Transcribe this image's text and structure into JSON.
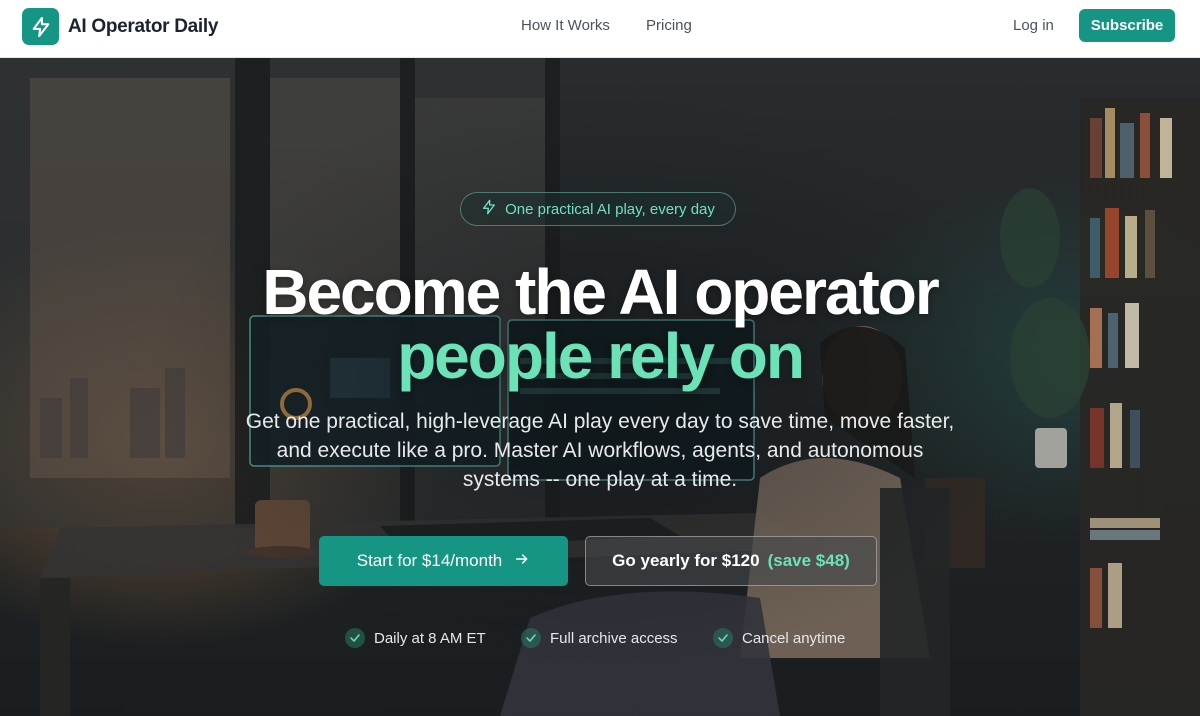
{
  "header": {
    "brand_name": "AI Operator Daily",
    "nav": [
      {
        "label": "How It Works"
      },
      {
        "label": "Pricing"
      }
    ],
    "login_label": "Log in",
    "subscribe_label": "Subscribe"
  },
  "hero": {
    "pill_text": "One practical AI play, every day",
    "headline_line1": "Become the AI operator",
    "headline_line2": "people rely on",
    "subheadline": "Get one practical, high-leverage AI play every day to save time, move faster, and execute like a pro. Master AI workflows, agents, and autonomous systems -- one play at a time.",
    "cta_primary": "Start for $14/month",
    "cta_secondary": "Go yearly for $120",
    "cta_secondary_save": "(save $48)",
    "checks": [
      {
        "label": "Daily at 8 AM ET"
      },
      {
        "label": "Full archive access"
      },
      {
        "label": "Cancel anytime"
      }
    ]
  },
  "colors": {
    "accent": "#169584",
    "headline_accent": "#6ce2b8",
    "pill_text": "#6fe0c3"
  },
  "icons": {
    "logo": "lightning-bolt-icon",
    "pill": "lightning-bolt-icon",
    "cta_arrow": "arrow-right-icon",
    "check": "check-icon"
  }
}
